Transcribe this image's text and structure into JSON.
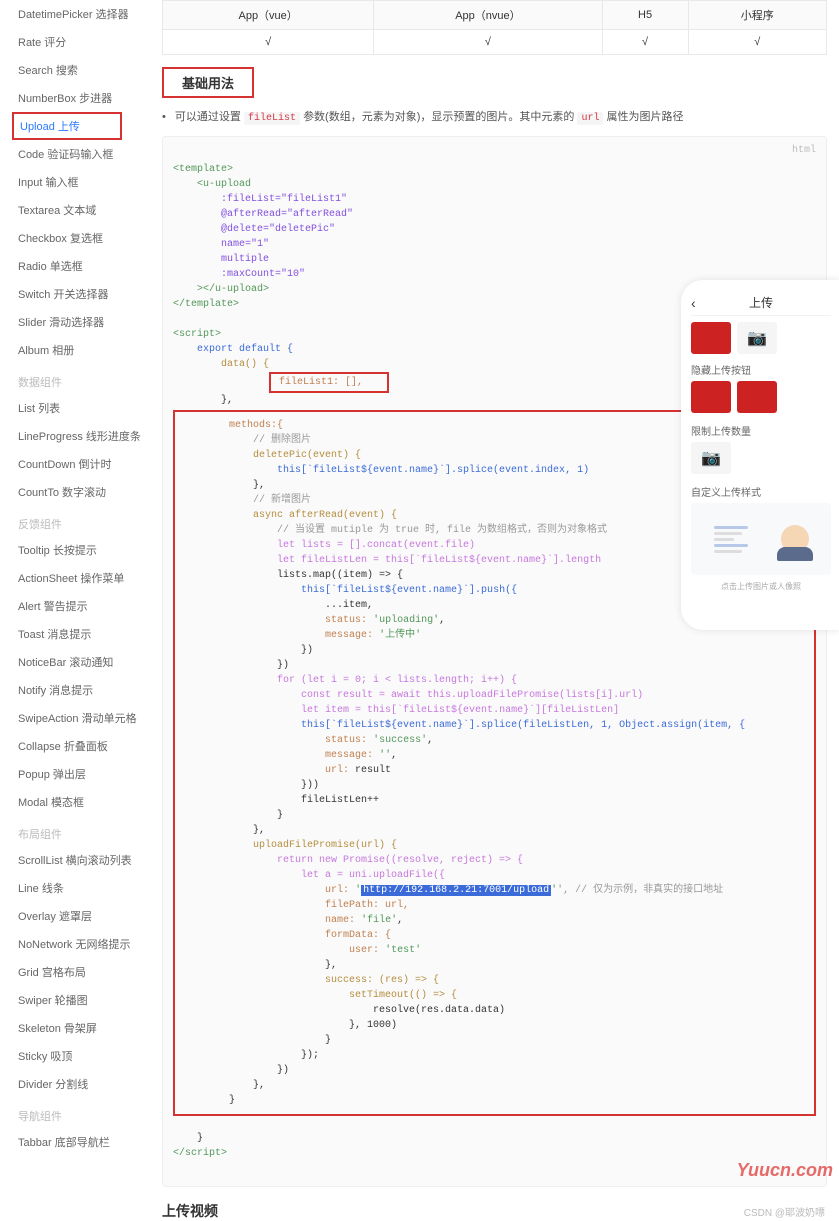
{
  "sidebar": {
    "items": [
      {
        "label": "DatetimePicker 选择器",
        "type": "item"
      },
      {
        "label": "Rate 评分",
        "type": "item"
      },
      {
        "label": "Search 搜索",
        "type": "item"
      },
      {
        "label": "NumberBox 步进器",
        "type": "item"
      },
      {
        "label": "Upload 上传",
        "type": "item",
        "active": true
      },
      {
        "label": "Code 验证码输入框",
        "type": "item"
      },
      {
        "label": "Input 输入框",
        "type": "item"
      },
      {
        "label": "Textarea 文本域",
        "type": "item"
      },
      {
        "label": "Checkbox 复选框",
        "type": "item"
      },
      {
        "label": "Radio 单选框",
        "type": "item"
      },
      {
        "label": "Switch 开关选择器",
        "type": "item"
      },
      {
        "label": "Slider 滑动选择器",
        "type": "item"
      },
      {
        "label": "Album 相册",
        "type": "item"
      },
      {
        "label": "数据组件",
        "type": "heading"
      },
      {
        "label": "List 列表",
        "type": "item"
      },
      {
        "label": "LineProgress 线形进度条",
        "type": "item"
      },
      {
        "label": "CountDown 倒计时",
        "type": "item"
      },
      {
        "label": "CountTo 数字滚动",
        "type": "item"
      },
      {
        "label": "反馈组件",
        "type": "heading"
      },
      {
        "label": "Tooltip 长按提示",
        "type": "item"
      },
      {
        "label": "ActionSheet 操作菜单",
        "type": "item"
      },
      {
        "label": "Alert 警告提示",
        "type": "item"
      },
      {
        "label": "Toast 消息提示",
        "type": "item"
      },
      {
        "label": "NoticeBar 滚动通知",
        "type": "item"
      },
      {
        "label": "Notify 消息提示",
        "type": "item"
      },
      {
        "label": "SwipeAction 滑动单元格",
        "type": "item"
      },
      {
        "label": "Collapse 折叠面板",
        "type": "item"
      },
      {
        "label": "Popup 弹出层",
        "type": "item"
      },
      {
        "label": "Modal 模态框",
        "type": "item"
      },
      {
        "label": "布局组件",
        "type": "heading"
      },
      {
        "label": "ScrollList 横向滚动列表",
        "type": "item"
      },
      {
        "label": "Line 线条",
        "type": "item"
      },
      {
        "label": "Overlay 遮罩层",
        "type": "item"
      },
      {
        "label": "NoNetwork 无网络提示",
        "type": "item"
      },
      {
        "label": "Grid 宫格布局",
        "type": "item"
      },
      {
        "label": "Swiper 轮播图",
        "type": "item"
      },
      {
        "label": "Skeleton 骨架屏",
        "type": "item"
      },
      {
        "label": "Sticky 吸顶",
        "type": "item"
      },
      {
        "label": "Divider 分割线",
        "type": "item"
      },
      {
        "label": "导航组件",
        "type": "heading"
      },
      {
        "label": "Tabbar 底部导航栏",
        "type": "item"
      }
    ]
  },
  "table": {
    "headers": [
      "App（vue）",
      "App（nvue）",
      "H5",
      "小程序"
    ],
    "row": [
      "√",
      "√",
      "√",
      "√"
    ]
  },
  "section_title": "基础用法",
  "desc_parts": {
    "p1": "可以通过设置",
    "tag1": "fileList",
    "p2": "参数(数组，元素为对象)，显示预置的图片。其中元素的",
    "tag2": "url",
    "p3": "属性为图片路径"
  },
  "code_lang": "html",
  "code": {
    "template_open": "<template>",
    "u_upload_open": "<u-upload",
    "attr_fileList": ":fileList=\"fileList1\"",
    "attr_afterRead": "@afterRead=\"afterRead\"",
    "attr_delete": "@delete=\"deletePic\"",
    "attr_name": "name=\"1\"",
    "attr_multiple": "multiple",
    "attr_maxCount": ":maxCount=\"10\"",
    "u_upload_close": "></u-upload>",
    "template_close": "</template>",
    "script_open": "<script>",
    "export_default": "export default {",
    "data_fn": "data() {",
    "fileList1": "fileList1: [],",
    "methods": "methods:{",
    "cmt_delete": "// 删除图片",
    "deletePic": "deletePic(event) {",
    "deletePic_body": "this[`fileList${event.name}`].splice(event.index, 1)",
    "cmt_add": "// 新增图片",
    "afterRead": "async afterRead(event) {",
    "cmt_multiple": "// 当设置 mutiple 为 true 时, file 为数组格式，否则为对象格式",
    "let_lists": "let lists = [].concat(event.file)",
    "let_fileListLen": "let fileListLen = this[`fileList${event.name}`].length",
    "lists_map": "lists.map((item) => {",
    "push_open": "this[`fileList${event.name}`].push({",
    "push_item": "...item,",
    "push_status": "status: 'uploading',",
    "push_message": "message: '上传中'",
    "for_loop": "for (let i = 0; i < lists.length; i++) {",
    "const_result": "const result = await this.uploadFilePromise(lists[i].url)",
    "let_item": "let item = this[`fileList${event.name}`][fileListLen]",
    "splice_line": "this[`fileList${event.name}`].splice(fileListLen, 1, Object.assign(item, {",
    "status_success": "status: 'success',",
    "message_empty": "message: '',",
    "url_result": "url: result",
    "fileListLen_inc": "fileListLen++",
    "uploadFP": "uploadFilePromise(url) {",
    "return_promise": "return new Promise((resolve, reject) => {",
    "let_a": "let a = uni.uploadFile({",
    "url_label": "url: '",
    "url_val": "http://192.168.2.21:7001/upload",
    "url_cmt": "', // 仅为示例，非真实的接口地址",
    "filePath": "filePath: url,",
    "name_file": "name: 'file',",
    "formData": "formData: {",
    "user_test": "user: 'test'",
    "success_fn": "success: (res) => {",
    "setTimeout": "setTimeout(() => {",
    "resolve": "resolve(res.data.data)",
    "timeout_val": "}, 1000)",
    "script_close": "</script>"
  },
  "section_title2": "上传视频",
  "watermark": "Yuucn.com",
  "csdn": "CSDN @耶波奶嘌",
  "phone": {
    "title": "上传",
    "label1": "隐藏上传按钮",
    "label2": "限制上传数量",
    "label3": "自定义上传样式",
    "custom_caption": "点击上传图片或人像照"
  }
}
